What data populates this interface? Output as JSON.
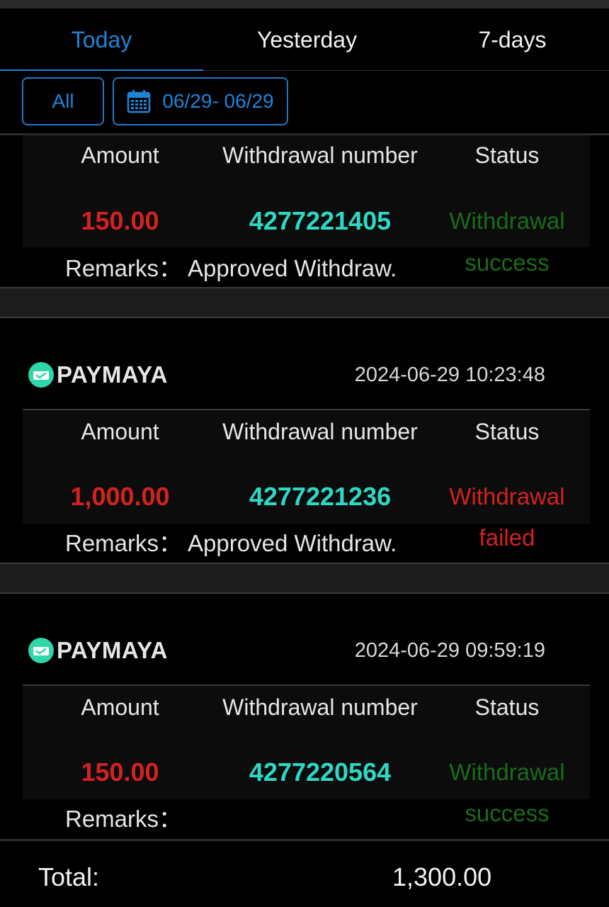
{
  "tabs": [
    {
      "label": "Today",
      "active": true
    },
    {
      "label": "Yesterday",
      "active": false
    },
    {
      "label": "7-days",
      "active": false
    }
  ],
  "filters": {
    "type_label": "All",
    "date_range": "06/29- 06/29"
  },
  "column_headers": {
    "amount": "Amount",
    "number": "Withdrawal number",
    "status": "Status"
  },
  "remarks_label": "Remarks：",
  "records": [
    {
      "method": "",
      "time": "",
      "amount": "150.00",
      "number": "4277221405",
      "status_line1": "Withdrawal",
      "status_line2": "success",
      "remarks": "Approved Withdraw."
    },
    {
      "method": "PAYMAYA",
      "time": "2024-06-29 10:23:48",
      "amount": "1,000.00",
      "number": "4277221236",
      "status_line1": "Withdrawal",
      "status_line2": "failed",
      "remarks": "Approved Withdraw."
    },
    {
      "method": "PAYMAYA",
      "time": "2024-06-29 09:59:19",
      "amount": "150.00",
      "number": "4277220564",
      "status_line1": "Withdrawal",
      "status_line2": "success",
      "remarks": ""
    }
  ],
  "footer": {
    "total_label": "Total:",
    "total_value": "1,300.00"
  },
  "colors": {
    "accent": "#1f84d8",
    "amount": "#d42121",
    "number": "#2fd8c4",
    "success": "#1a6b1a",
    "failed": "#d42121"
  },
  "icons": {
    "calendar": "calendar-icon",
    "method": "paymaya-icon"
  }
}
